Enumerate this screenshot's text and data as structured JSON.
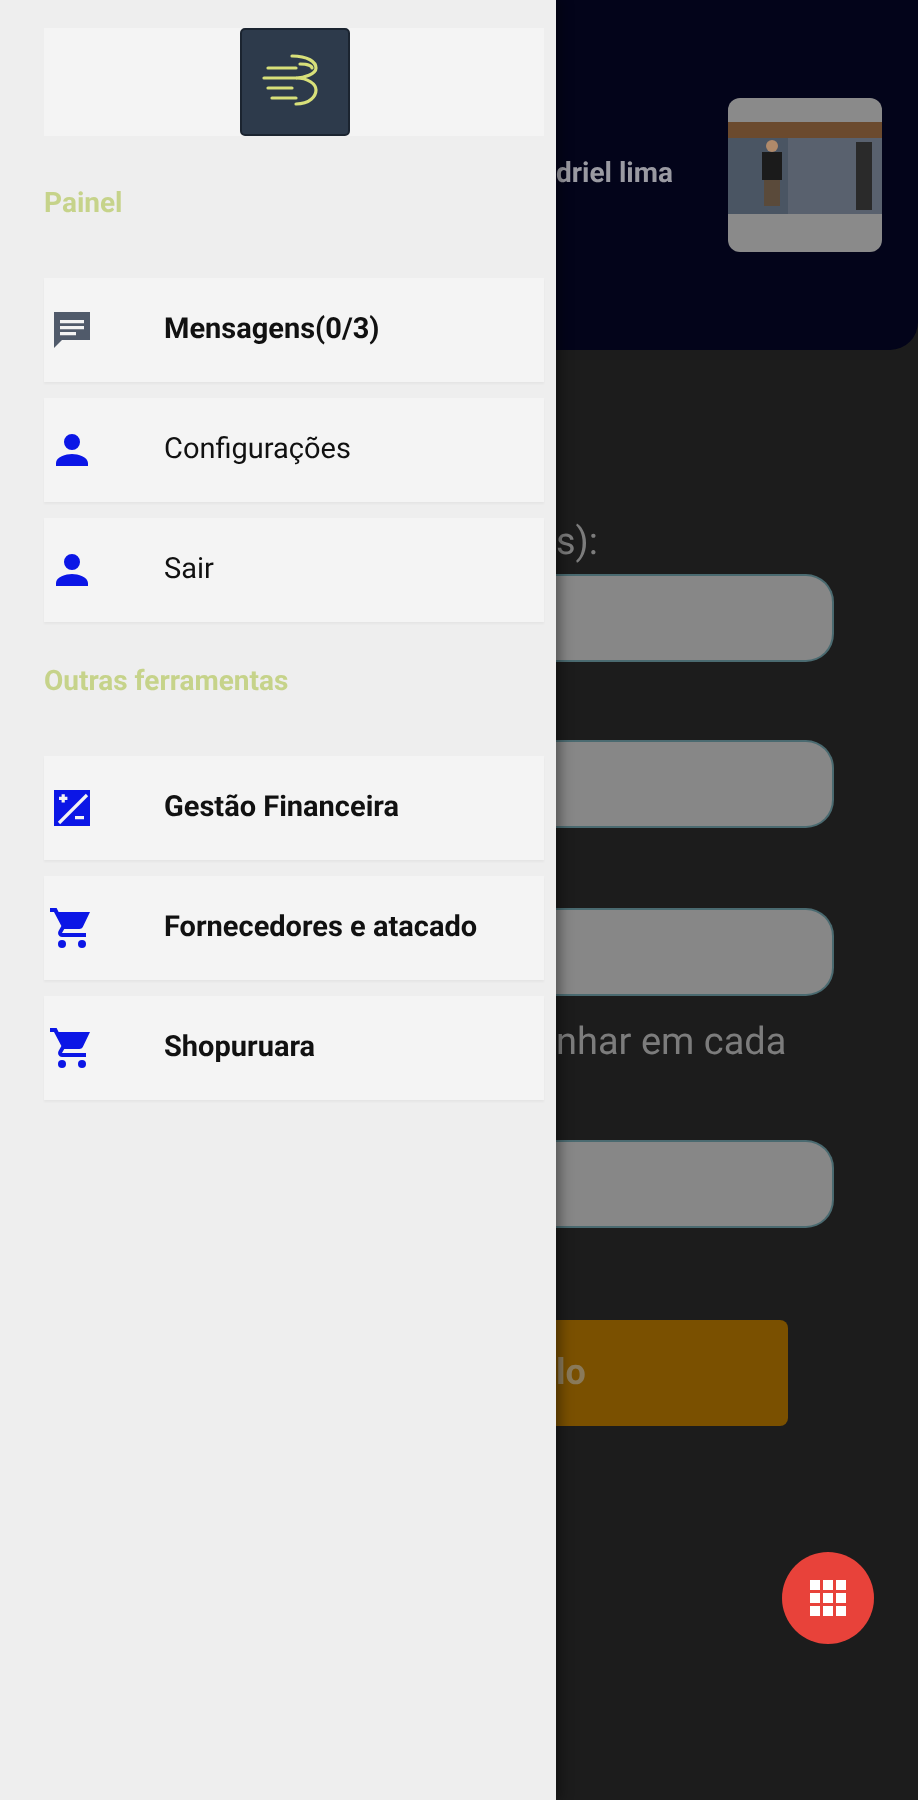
{
  "drawer": {
    "sections": [
      {
        "title": "Painel",
        "items": [
          {
            "label": "Mensagens(0/3)",
            "kind": "chat"
          },
          {
            "label": "Configurações",
            "kind": "person"
          },
          {
            "label": "Sair",
            "kind": "person"
          }
        ]
      },
      {
        "title": "Outras ferramentas",
        "items": [
          {
            "label": "Gestão Financeira",
            "kind": "finance"
          },
          {
            "label": "Fornecedores e atacado",
            "kind": "cart"
          },
          {
            "label": "Shopuruara",
            "kind": "cart"
          }
        ]
      }
    ]
  },
  "header": {
    "name": "driel lima"
  },
  "form": {
    "items": [
      {
        "kind": "label",
        "text": "s):"
      },
      {
        "kind": "field"
      },
      {
        "kind": "field"
      },
      {
        "kind": "field"
      },
      {
        "kind": "label",
        "text": "nhar em cada"
      },
      {
        "kind": "field"
      },
      {
        "kind": "button",
        "text": "lo"
      }
    ]
  }
}
